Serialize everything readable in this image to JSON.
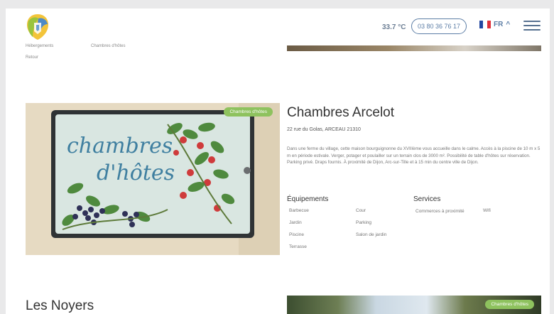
{
  "header": {
    "temperature": "33.7 °C",
    "phone": "03 80 36 76 17",
    "language": "FR",
    "language_caret": "^"
  },
  "breadcrumbs": [
    "Hébergements",
    "Chambres d'hôtes",
    "Retour"
  ],
  "listing": {
    "badge": "Chambres d'hôtes",
    "title": "Chambres Arcelot",
    "address": "22 rue du Golas, ARCEAU 21310",
    "description": "Dans une ferme du village, cette maison bourguignonne du XVIIIème vous accueille dans le calme. Accès à la piscine de 10 m x 5 m en période estivale. Verger, potager et poulailler sur un terrain clos de 3000 m². Possibilité de table d'hôtes sur réservation. Parking privé. Draps fournis. À proximité de Dijon, Arc-sur-Tille et à 15 min du centre ville de Dijon.",
    "sign_line1": "chambres",
    "sign_line2": "d'hôtes",
    "equipements_title": "Équipements",
    "equipements_col1": [
      "Barbecue",
      "Jardin",
      "Piscine",
      "Terrasse"
    ],
    "equipements_col2": [
      "Cour",
      "Parking",
      "Salon de jardin"
    ],
    "services_title": "Services",
    "services_col1": [
      "Commerces à proximité"
    ],
    "services_col2": [
      "Wifi"
    ]
  },
  "next_listing": {
    "title": "Les Noyers",
    "badge": "Chambres d'hôtes"
  },
  "colors": {
    "accent_blue": "#5d7ea6",
    "badge_green": "#8ec25e",
    "flag_blue": "#2346a0",
    "flag_red": "#e0303a"
  }
}
